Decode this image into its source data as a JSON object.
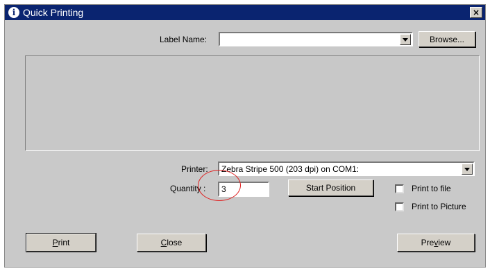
{
  "window": {
    "title": "Quick Printing",
    "close_glyph": "×"
  },
  "label_name": {
    "label": "Label Name:",
    "value": ""
  },
  "browse_button": "Browse...",
  "printer": {
    "label": "Printer:",
    "value": "Zebra Stripe 500 (203 dpi) on COM1:"
  },
  "quantity": {
    "label": "Quantity :",
    "value": "3"
  },
  "start_position_button": "Start Position",
  "print_to_file": {
    "label": "Print to file",
    "checked": false
  },
  "print_to_picture": {
    "label": "Print to Picture",
    "checked": false
  },
  "buttons": {
    "print_hotkey": "P",
    "print_rest": "rint",
    "close_hotkey": "C",
    "close_rest": "lose",
    "preview_pre": "Pre",
    "preview_hotkey": "v",
    "preview_rest": "iew"
  },
  "colors": {
    "titlebar": "#0a2470",
    "annotation_circle": "#e02020"
  }
}
